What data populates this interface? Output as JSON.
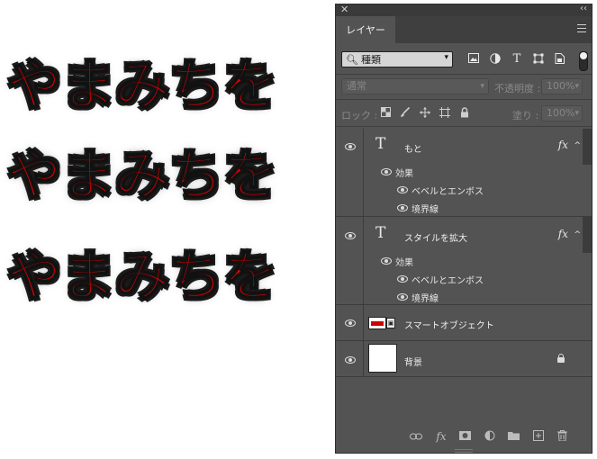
{
  "canvas": {
    "art_texts": [
      "やまみちを",
      "やまみちを",
      "やまみちを"
    ],
    "text_color": "#e00000",
    "stroke_color": "#111111"
  },
  "panel": {
    "title": "レイヤー",
    "filter": {
      "value": "種類",
      "icons": [
        "image-icon",
        "adjustment-icon",
        "type-icon",
        "shape-icon",
        "smart-object-icon"
      ]
    },
    "blend_mode": "通常",
    "opacity_label": "不透明度 :",
    "opacity_value": "100%",
    "lock_label": "ロック :",
    "fill_label": "塗り :",
    "fill_value": "100%",
    "layers": [
      {
        "name": "もと",
        "kind": "text",
        "fx": "fx",
        "effects_label": "効果",
        "effects": [
          "ベベルとエンボス",
          "境界線"
        ]
      },
      {
        "name": "スタイルを拡大",
        "kind": "text",
        "fx": "fx",
        "effects_label": "効果",
        "effects": [
          "ベベルとエンボス",
          "境界線"
        ]
      },
      {
        "name": "スマートオブジェクト",
        "kind": "smart-object"
      },
      {
        "name": "背景",
        "kind": "background",
        "locked": true
      }
    ],
    "type_glyph": "T"
  }
}
